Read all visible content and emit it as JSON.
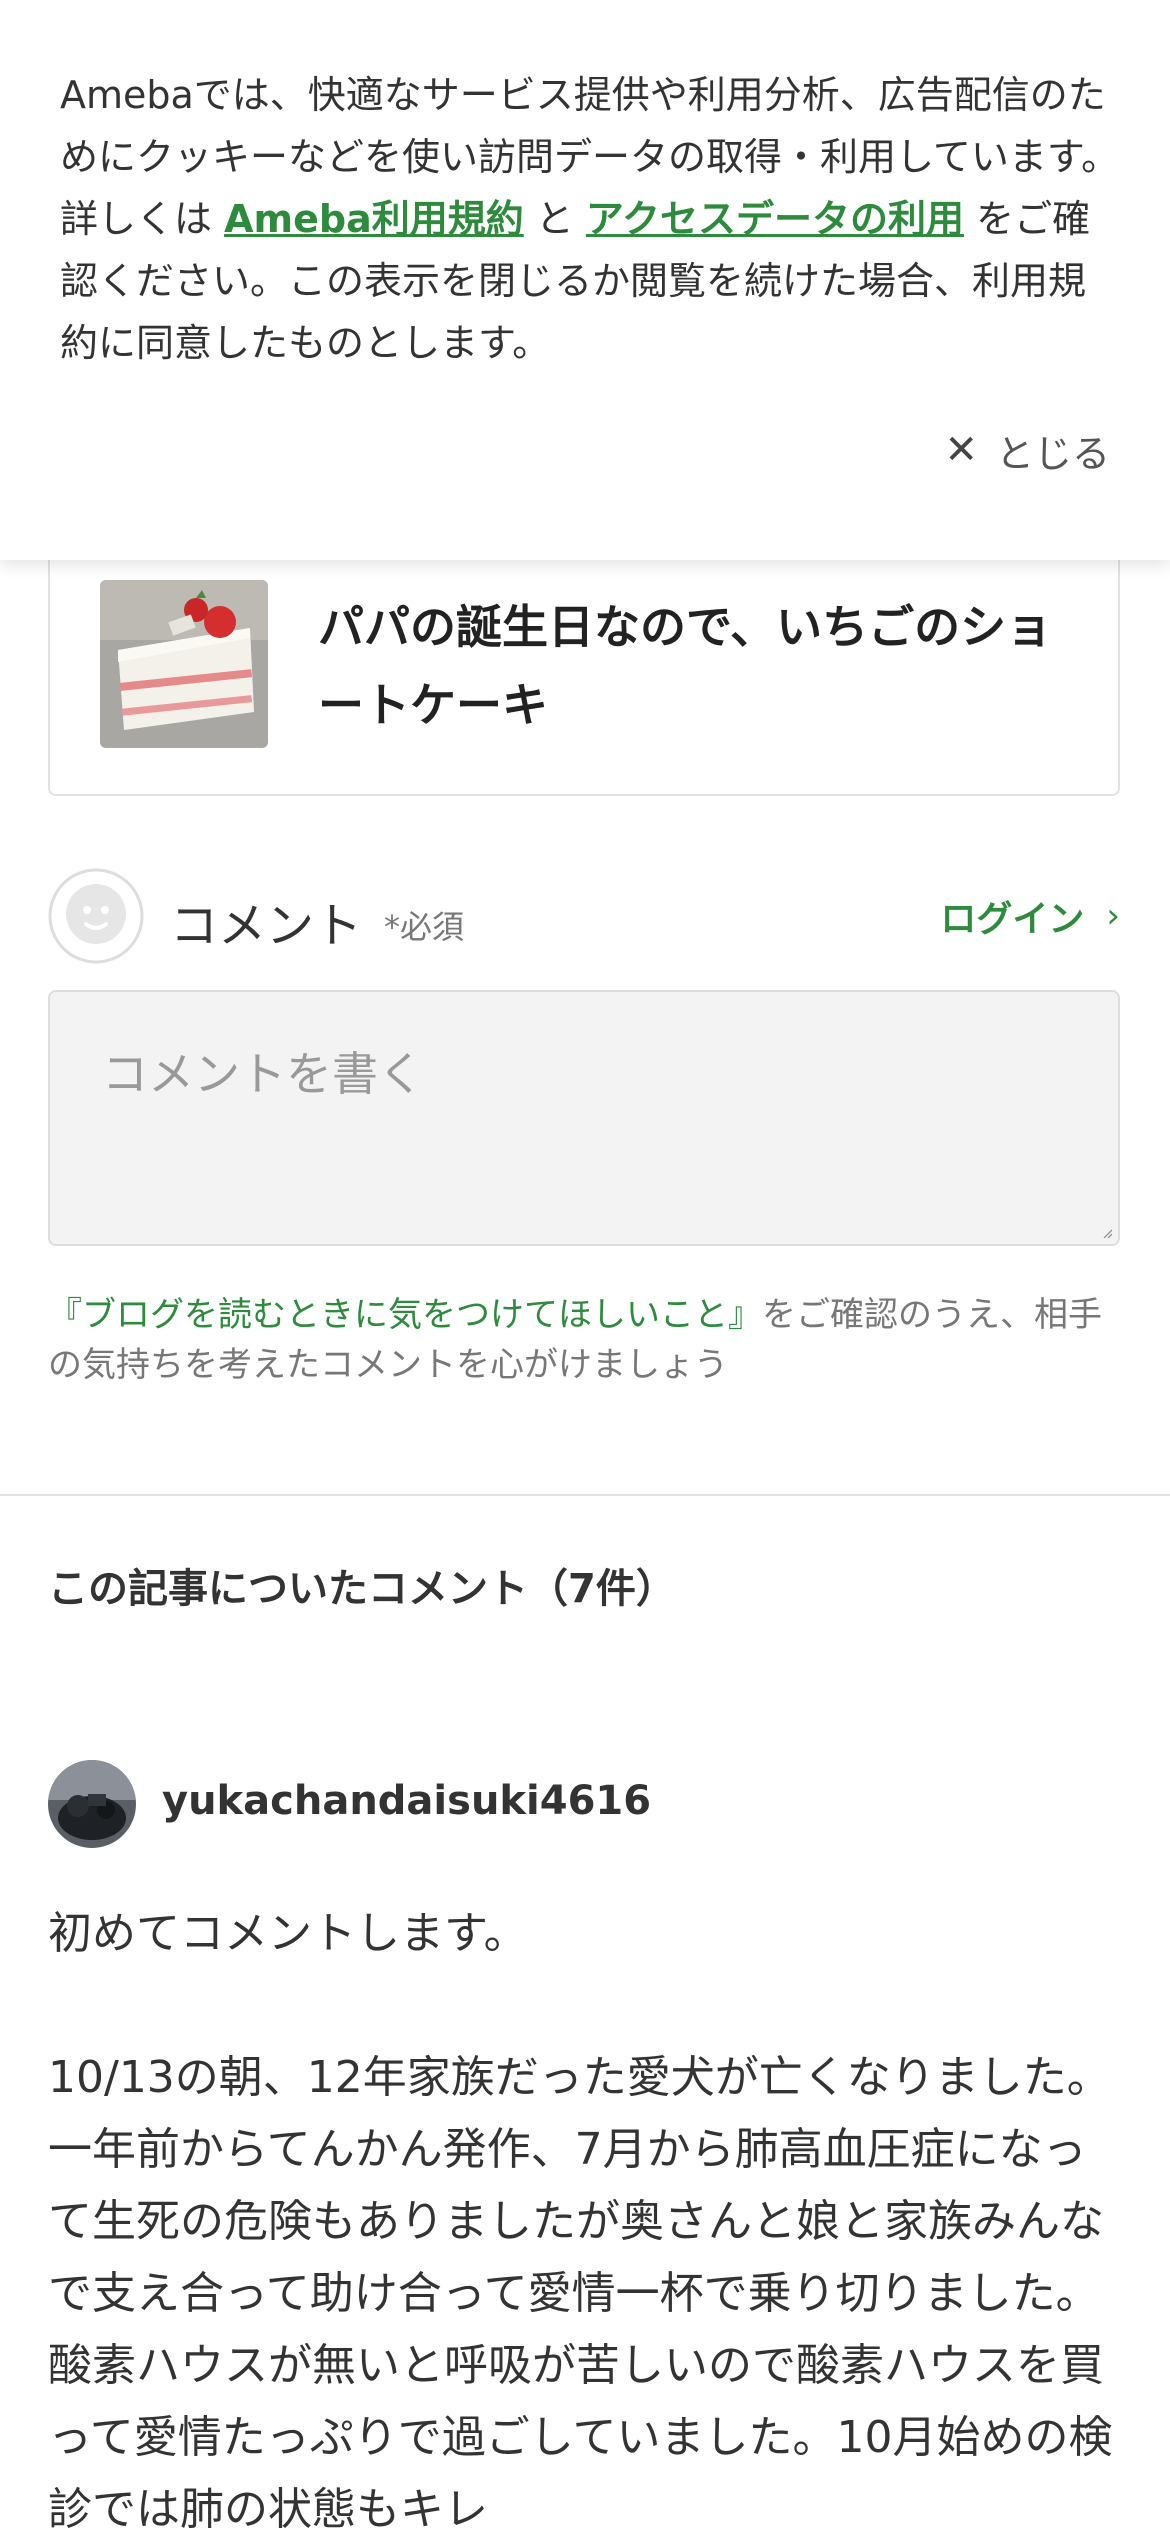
{
  "cookie_banner": {
    "text_before": "Amebaでは、快適なサービス提供や利用分析、広告配信のためにクッキーなどを使い訪問データの取得・利用しています。詳しくは ",
    "link_terms": "Ameba利用規約",
    "text_and": " と ",
    "link_access": "アクセスデータの利用",
    "text_after": " をご確認ください。この表示を閉じるか閲覧を続けた場合、利用規約に同意したものとします。",
    "close_label": "とじる",
    "link_color": "#2e8b3d"
  },
  "article": {
    "title": "パパの誕生日なので、いちごのショートケーキ",
    "thumbnail": "strawberry-shortcake-photo"
  },
  "comment_form": {
    "label": "コメント",
    "required": "*必須",
    "login": "ログイン",
    "placeholder": "コメントを書く",
    "guideline_link": "『ブログを読むときに気をつけてほしいこと』",
    "guideline_text": "をご確認のうえ、相手の気持ちを考えたコメントを心がけましょう"
  },
  "comments": {
    "heading": "この記事についたコメント（7件）",
    "items": [
      {
        "username": "yukachandaisuki4616",
        "line1": "初めてコメントします。",
        "line2": "10/13の朝、12年家族だった愛犬が亡くなりました。一年前からてんかん発作、7月から肺高血圧症になって生死の危険もありましたが奥さんと娘と家族みんなで支え合って助け合って愛情一杯で乗り切りました。酸素ハウスが無いと呼吸が苦しいので酸素ハウスを買って愛情たっぷりで過ごしていました。10月始めの検診では肺の状態もキレ"
      }
    ]
  }
}
